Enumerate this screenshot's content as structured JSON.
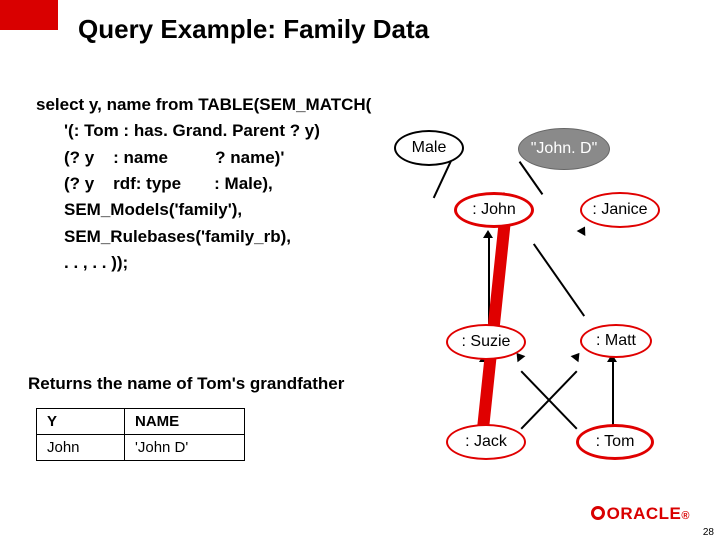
{
  "title": "Query Example: Family Data",
  "query": {
    "l1": "select y, name from TABLE(SEM_MATCH(",
    "l2": "'(: Tom : has. Grand. Parent ? y)",
    "l3": "(? y    : name          ? name)'",
    "l4": "(? y    rdf: type       : Male),",
    "l5": "SEM_Models('family'),",
    "l6": "SEM_Rulebases('family_rb),",
    "l7": ". . , . . ));"
  },
  "caption": "Returns the name of Tom's grandfather",
  "table": {
    "hdr_y": "Y",
    "hdr_name": "NAME",
    "row_y": "John",
    "row_name": "'John D'"
  },
  "graph": {
    "male": "Male",
    "johnd": "\"John. D\"",
    "john": ": John",
    "janice": ": Janice",
    "suzie": ": Suzie",
    "matt": ": Matt",
    "jack": ": Jack",
    "tom": ": Tom"
  },
  "logo": "ORACLE",
  "page": "28"
}
